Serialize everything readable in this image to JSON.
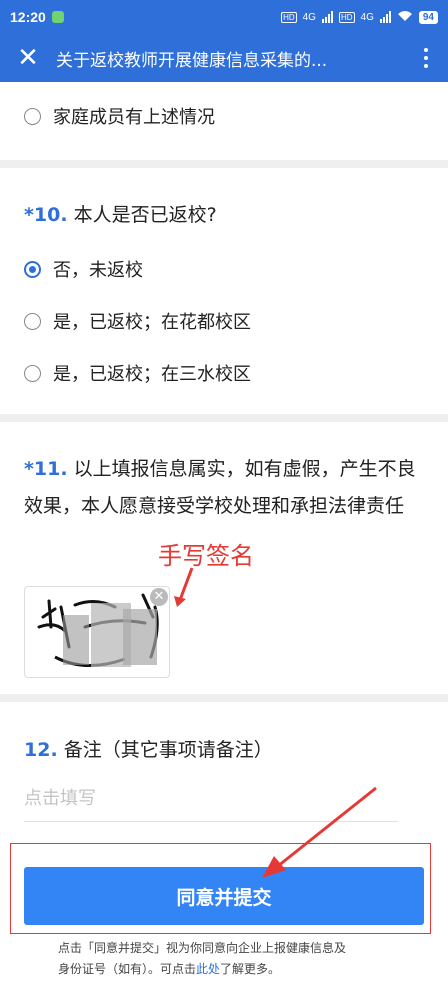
{
  "status": {
    "time": "12:20",
    "net1": "4G",
    "net2": "4G",
    "battery": "94",
    "hd": "HD"
  },
  "titlebar": {
    "title": "关于返校教师开展健康信息采集的..."
  },
  "q9": {
    "option_last": "家庭成员有上述情况"
  },
  "q10": {
    "num": "*10.",
    "text": "本人是否已返校?",
    "options": [
      "否，未返校",
      "是，已返校；在花都校区",
      "是，已返校；在三水校区"
    ]
  },
  "q11": {
    "num": "*11.",
    "text": "以上填报信息属实，如有虚假，产生不良效果，本人愿意接受学校处理和承担法律责任"
  },
  "annotation": {
    "signature_label": "手写签名"
  },
  "q12": {
    "num": "12.",
    "text": "备注（其它事项请备注）",
    "placeholder": "点击填写"
  },
  "submit": {
    "label": "同意并提交"
  },
  "footer": {
    "line1": "点击「同意并提交」视为你同意向企业上报健康信息及",
    "line2_pre": "身份证号（如有）。可点击",
    "line2_link": "此处",
    "line2_post": "了解更多。"
  },
  "colors": {
    "brand": "#2e6fd9",
    "button": "#3385f5",
    "annotation": "#e53935"
  }
}
